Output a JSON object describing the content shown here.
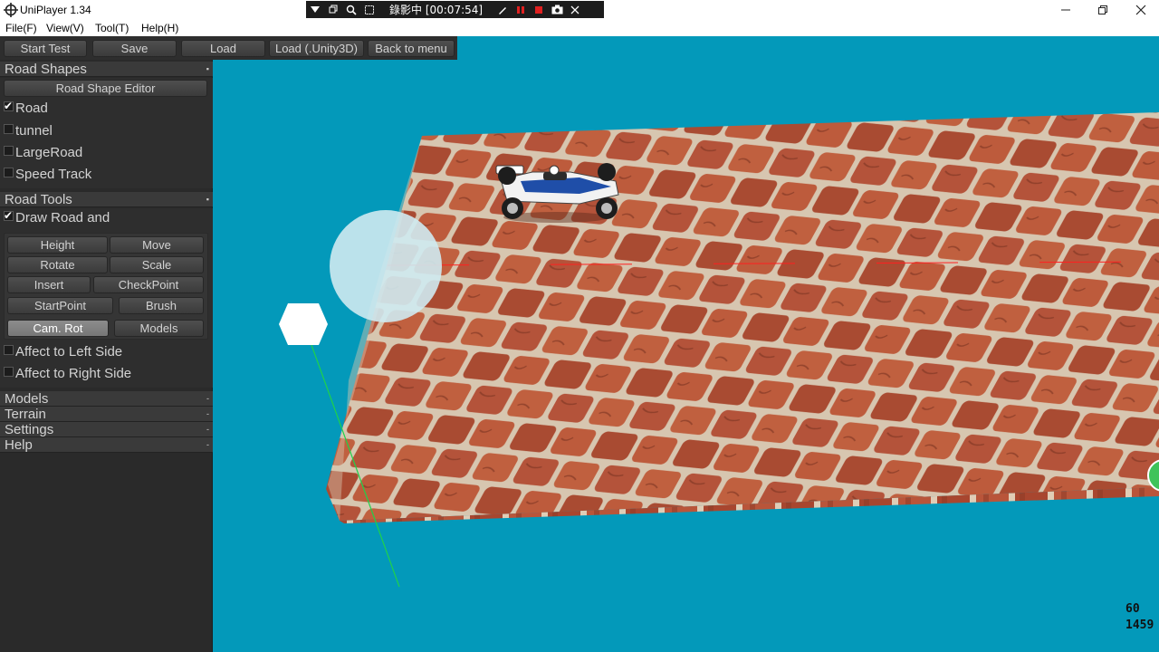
{
  "window": {
    "title": "UniPlayer 1.34",
    "controls": [
      "minimize",
      "restore",
      "close"
    ]
  },
  "menu": [
    {
      "label": "File(F)"
    },
    {
      "label": "View(V)"
    },
    {
      "label": "Tool(T)"
    },
    {
      "label": "Help(H)"
    }
  ],
  "recorder": {
    "status_text": "錄影中 [00:07:54]",
    "icons": [
      "menu-dropdown-icon",
      "restore-icon",
      "zoom-icon",
      "crop-icon",
      "pen-icon",
      "pause-icon",
      "stop-icon",
      "camera-icon",
      "close-icon"
    ]
  },
  "toolbar": {
    "start_test": "Start Test",
    "save": "Save",
    "load": "Load",
    "load_unity": "Load (.Unity3D)",
    "back_to_menu": "Back to menu"
  },
  "sections": {
    "road_shapes": {
      "title": "Road Shapes",
      "editor_button": "Road Shape Editor",
      "toggles": [
        {
          "label": "Road",
          "checked": true
        },
        {
          "label": "tunnel",
          "checked": false
        },
        {
          "label": "LargeRoad",
          "checked": false
        },
        {
          "label": "Speed Track",
          "checked": false
        }
      ]
    },
    "road_tools": {
      "title": "Road Tools",
      "draw_toggle": {
        "label": "Draw Road and",
        "checked": true
      },
      "buttons": {
        "height": "Height",
        "move": "Move",
        "rotate": "Rotate",
        "scale": "Scale",
        "insert": "Insert",
        "checkpoint": "CheckPoint",
        "startpoint": "StartPoint",
        "brush": "Brush",
        "cam_rot": "Cam. Rot",
        "models": "Models"
      },
      "active_button": "Cam. Rot",
      "affect_left": {
        "label": "Affect to Left Side",
        "checked": false
      },
      "affect_right": {
        "label": "Affect to Right Side",
        "checked": false
      }
    },
    "collapsed": [
      {
        "title": "Models"
      },
      {
        "title": "Terrain"
      },
      {
        "title": "Settings"
      },
      {
        "title": "Help"
      }
    ]
  },
  "hud": {
    "fps": "60",
    "count": "1459"
  },
  "colors": {
    "sky": "#0399ba",
    "panel": "#2e2e2e",
    "brick": "#b1533a",
    "mortar": "#d9c8b4"
  }
}
